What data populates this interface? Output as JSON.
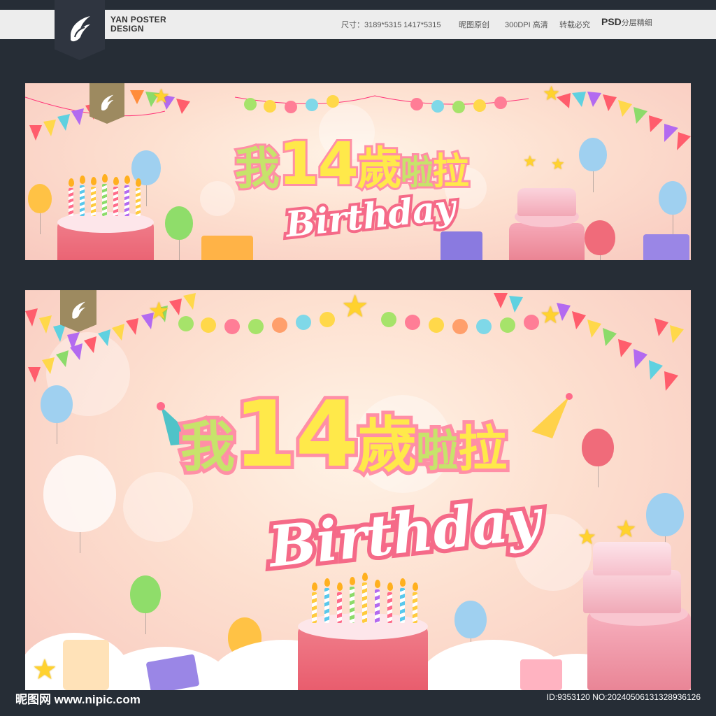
{
  "header": {
    "brand_line1": "YAN POSTER",
    "brand_line2": "DESIGN",
    "size_label": "尺寸：3189*5315  1417*5315",
    "original": "昵图原创",
    "dpi": "300DPI 高清",
    "copyright": "转载必究",
    "psd_big": "PSD",
    "psd_small": "分层精细"
  },
  "banner": {
    "title_cn": [
      "我",
      "14",
      "歲",
      "啦",
      "拉"
    ],
    "title_en": "Birthday"
  },
  "footer": {
    "site": "昵图网 www.nipic.com",
    "id_text": "ID:9353120 NO:20240506131328936126"
  },
  "colors": {
    "background": "#262d36",
    "banner_pink": "#f8c9bf",
    "title_yellow": "#ffe94a",
    "title_green": "#c8e86a",
    "title_outline": "#ff8fa6",
    "accent_blue": "#8fd3ec"
  }
}
